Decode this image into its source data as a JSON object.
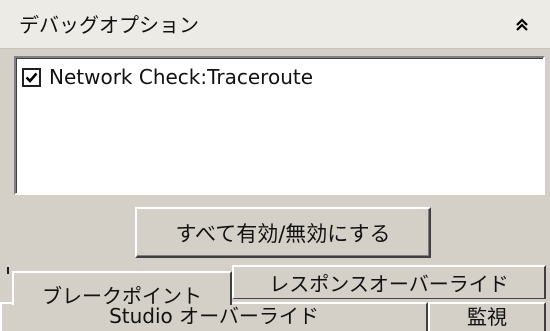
{
  "panel": {
    "title": "デバッグオプション",
    "collapse_icon": "double-chevron-up-icon"
  },
  "options_list": {
    "items": [
      {
        "label": "Network Check:Traceroute",
        "checked": true
      }
    ]
  },
  "toggle_all_button": {
    "label": "すべて有効/無効にする"
  },
  "tabs": [
    {
      "label": "ブレークポイント",
      "selected": true
    },
    {
      "label": "レスポンスオーバーライド",
      "selected": false
    },
    {
      "label": "Studio オーバーライド",
      "selected": false
    },
    {
      "label": "監視",
      "selected": false
    }
  ]
}
